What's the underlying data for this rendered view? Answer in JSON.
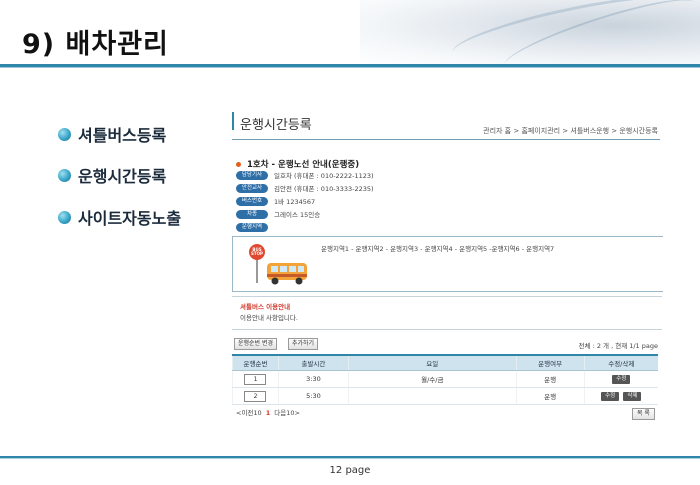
{
  "title": "9) 배차관리",
  "bullets": [
    "셔틀버스등록",
    "운행시간등록",
    "사이트자동노출"
  ],
  "section_title": "운행시간등록",
  "breadcrumb": "관리자 홈 > 홈페이지관리 > 셔틀버스운행 > 운행시간등록",
  "route_title": "1호차 - 운행노선 안내(운행중)",
  "info": [
    {
      "label": "담당기사",
      "value": "일호차 (휴대폰 : 010-2222-1123)"
    },
    {
      "label": "안전교사",
      "value": "김안전 (휴대폰 : 010-3333-2235)"
    },
    {
      "label": "버스번호",
      "value": "1바 1234567"
    },
    {
      "label": "차종",
      "value": "그레이스 15인승"
    },
    {
      "label": "운행지역",
      "value": ""
    }
  ],
  "bus_sign": "BUS STOP",
  "route_stops": "운행지역1 - 운행지역2 - 운행지역3 - 운행지역4 - 운행지역5 -운행지역6 - 운행지역7",
  "notice_title": "셔틀버스 이용안내",
  "notice_text": "이용안내 사항입니다.",
  "buttons": {
    "order_change": "운행순번 변경",
    "add": "추가하기",
    "list": "목 록"
  },
  "total_info": "전체 : 2 개 ,  현재 1/1 page",
  "table": {
    "headers": [
      "운행순번",
      "출발시간",
      "요일",
      "운행여부",
      "수정/삭제"
    ],
    "rows": [
      {
        "order": "1",
        "time": "3:30",
        "days": "월/수/금",
        "status": "운행",
        "edit": "수정",
        "delete": ""
      },
      {
        "order": "2",
        "time": "5:30",
        "days": "",
        "status": "운행",
        "edit": "수정",
        "delete": "삭제"
      }
    ]
  },
  "pager": {
    "prev": "<이전10",
    "current": "1",
    "next": "다음10>"
  },
  "footer_page": "12 page",
  "colors": {
    "accent": "#2f86a8",
    "label_bg": "#2f6fa8",
    "notice_red": "#d0392b"
  }
}
